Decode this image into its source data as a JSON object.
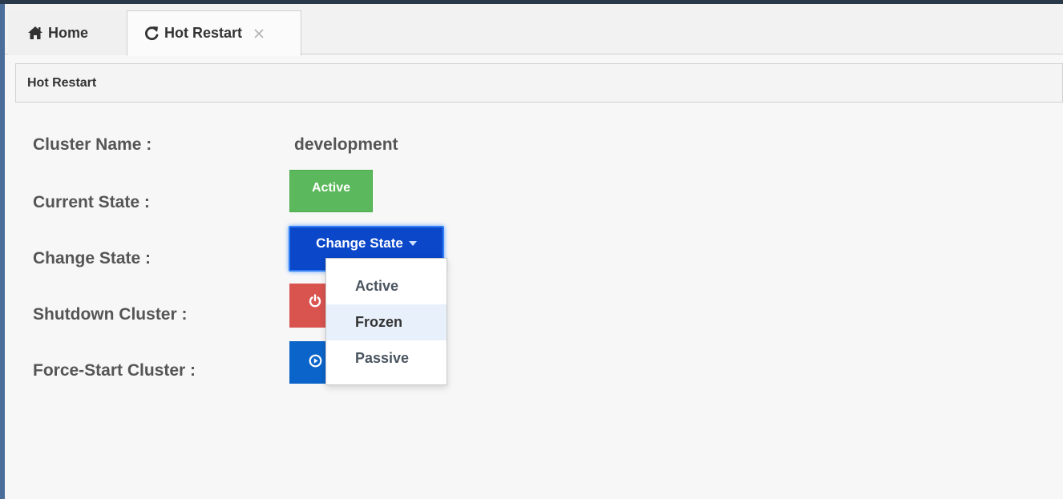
{
  "tabs": [
    {
      "label": "Home",
      "icon": "home-icon"
    },
    {
      "label": "Hot Restart",
      "icon": "refresh-icon",
      "closable": true
    }
  ],
  "panel": {
    "title": "Hot Restart"
  },
  "form": {
    "cluster_name_label": "Cluster Name :",
    "cluster_name_value": "development",
    "current_state_label": "Current State :",
    "current_state_value": "Active",
    "change_state_label": "Change State :",
    "change_state_button": "Change State",
    "shutdown_label": "Shutdown Cluster :",
    "force_start_label": "Force-Start Cluster :"
  },
  "dropdown": {
    "options": [
      "Active",
      "Frozen",
      "Passive"
    ],
    "highlighted": "Frozen"
  },
  "colors": {
    "active_badge": "#5cb85c",
    "change_state_button": "#0a47c9",
    "shutdown_button": "#d9534f",
    "force_start_button": "#0b64c9"
  }
}
